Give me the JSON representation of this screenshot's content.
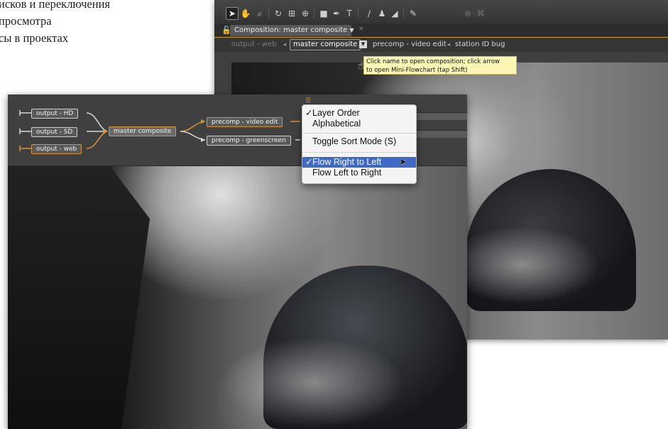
{
  "book_text": {
    "lines": [
      "исков и переключения",
      "просмотра",
      "сы в проектах"
    ]
  },
  "back_window": {
    "toolbar": {
      "tools": [
        "selection-tool",
        "hand-tool",
        "zoom-tool",
        "rotation-tool",
        "camera-orbit-tool",
        "pan-behind-tool",
        "rectangle-tool",
        "pen-tool",
        "type-tool",
        "brush-tool",
        "clone-stamp-tool",
        "eraser-tool",
        "puppet-tool"
      ]
    },
    "composition_tab": {
      "label": "Composition: master composite"
    },
    "navigator": {
      "items": [
        "output - web",
        "master composite",
        "precomp - video edit",
        "station ID bug"
      ]
    },
    "tooltip": {
      "line1": "Click name to open composition; click arrow",
      "line2": "to open Mini-Flowchart (tap Shift)"
    }
  },
  "flowchart": {
    "outputs": [
      "output - HD",
      "output - SD",
      "output - web"
    ],
    "master": "master composite",
    "precomps": [
      "precomp - video edit",
      "precomp - greenscreen"
    ]
  },
  "context_menu": {
    "items": [
      {
        "label": "Layer Order",
        "checked": true,
        "highlighted": false
      },
      {
        "label": "Alphabetical",
        "checked": false,
        "highlighted": false
      },
      {
        "label": "Toggle Sort Mode  (S)",
        "checked": false,
        "highlighted": false
      },
      {
        "label": "Flow Right to Left",
        "checked": true,
        "highlighted": true
      },
      {
        "label": "Flow Left to Right",
        "checked": false,
        "highlighted": false
      }
    ]
  },
  "colors": {
    "flow_accent": "#d9943a",
    "menu_highlight": "#3f69c4",
    "tooltip_bg": "#fbf6b4",
    "tab_underline": "#c8a034"
  }
}
